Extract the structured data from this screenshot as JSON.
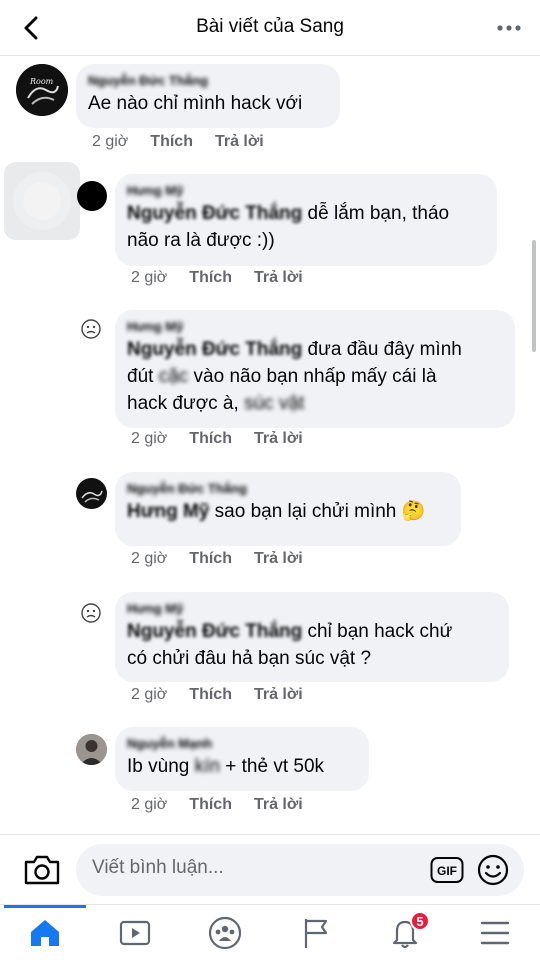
{
  "header": {
    "title": "Bài viết của Sang",
    "back_icon": "chevron-left-icon",
    "more_icon": "more-horizontal-icon"
  },
  "comments": [
    {
      "author": "Nguyễn Đức Thắng",
      "text": "Ae nào chỉ mình hack với",
      "time": "2 giờ",
      "like": "Thích",
      "reply": "Trả lời"
    },
    {
      "author": "Hưng Mỹ",
      "mention": "Nguyễn Đức Thắng",
      "text_1": " dễ lắm bạn, tháo",
      "text_2": "não ra là được :))",
      "time": "2 giờ",
      "like": "Thích",
      "reply": "Trả lời"
    },
    {
      "author": "Hưng Mỹ",
      "mention": "Nguyễn Đức Thắng",
      "text_1": "  đưa đầu đây mình",
      "text_2a": "đút ",
      "text_2_blur": "cặc",
      "text_2b": " vào não bạn nhấp mấy cái là",
      "text_3a": "hack được à, ",
      "text_3_blur": "súc vật",
      "time": "2 giờ",
      "like": "Thích",
      "reply": "Trả lời"
    },
    {
      "author": "Nguyễn Đức Thắng",
      "mention": "Hưng Mỹ",
      "text": "  sao bạn lại chửi mình 🤔",
      "time": "2 giờ",
      "like": "Thích",
      "reply": "Trả lời"
    },
    {
      "author": "Hưng Mỹ",
      "mention": "Nguyễn Đức Thắng",
      "text_1": "  chỉ bạn hack chứ",
      "text_2": "có chửi đâu hả bạn súc vật ?",
      "time": "2 giờ",
      "like": "Thích",
      "reply": "Trả lời"
    },
    {
      "author": "Nguyễn Mạnh",
      "text_a": "Ib vùng ",
      "text_blur": "kín",
      "text_b": " + thẻ vt 50k",
      "time": "2 giờ",
      "like": "Thích",
      "reply": "Trả lời"
    }
  ],
  "composer": {
    "placeholder": "Viết bình luận...",
    "camera_icon": "camera-icon",
    "gif_label": "GIF",
    "emoji_icon": "smiley-icon"
  },
  "tabbar": {
    "tabs": [
      "home-icon",
      "video-icon",
      "groups-icon",
      "pages-flag-icon",
      "notifications-bell-icon",
      "menu-icon"
    ],
    "notifications_badge": "5"
  },
  "colors": {
    "accent": "#1877f2",
    "bubble": "#f0f2f5",
    "secondary_text": "#65676b",
    "badge": "#e41e3f"
  }
}
